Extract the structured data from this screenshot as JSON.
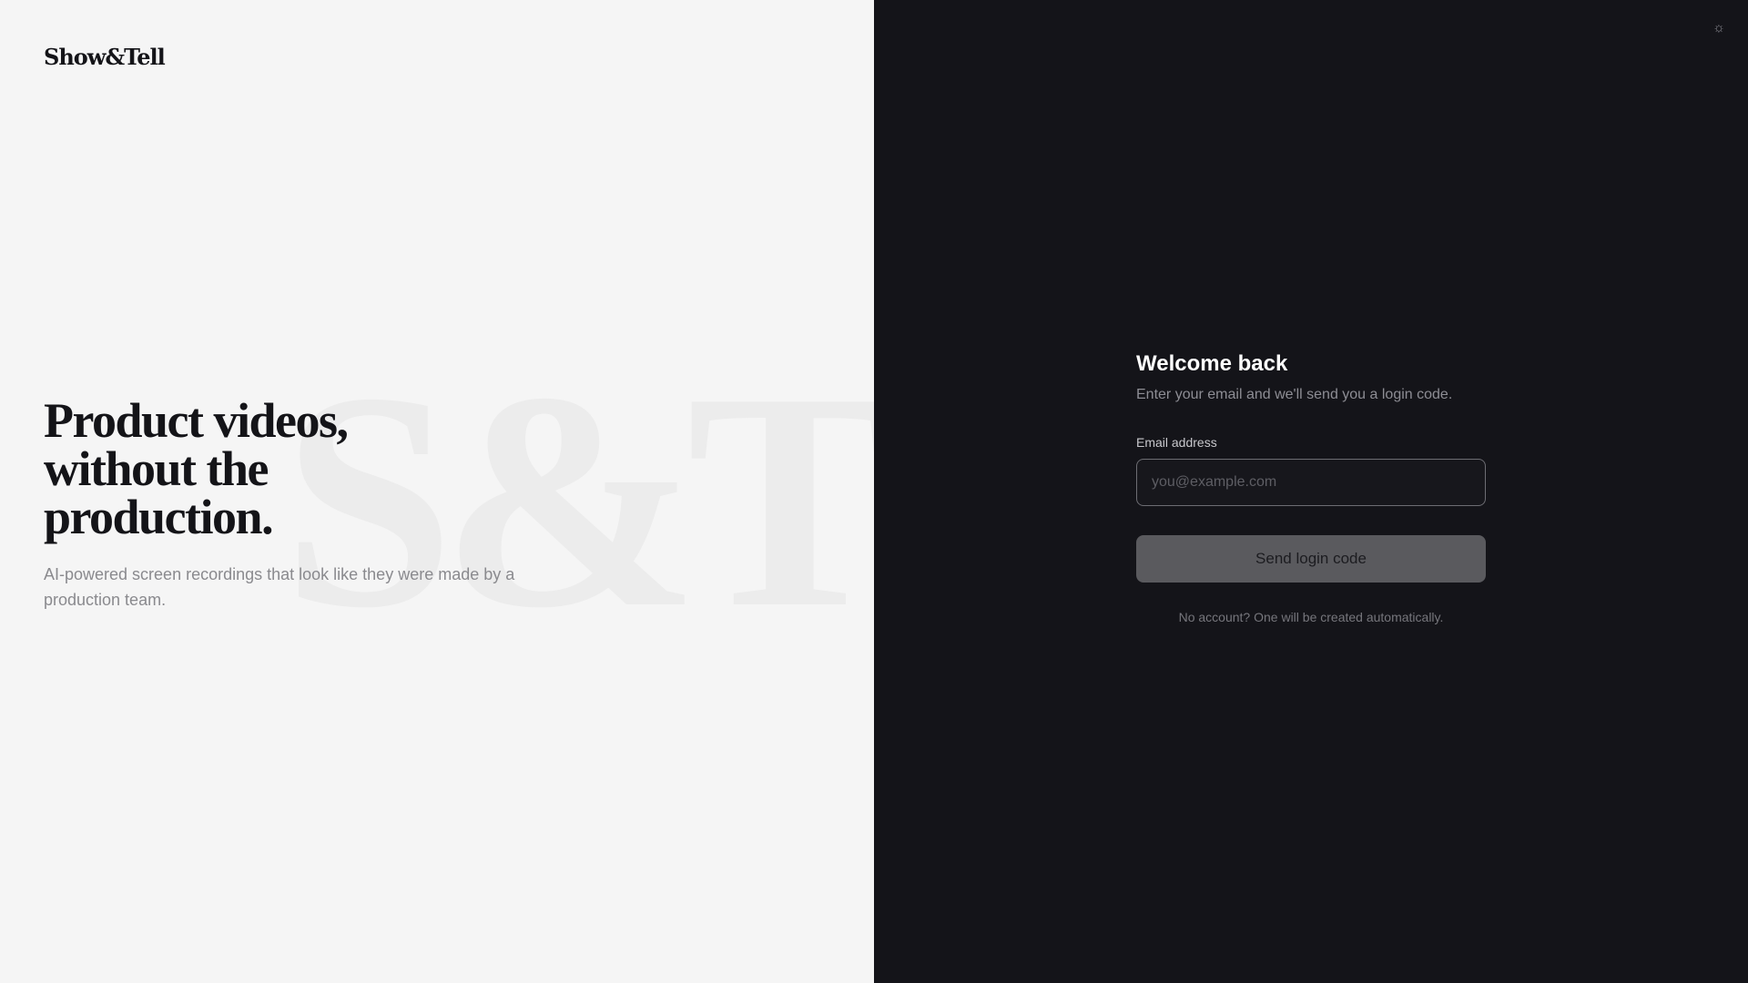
{
  "brand": {
    "logo_text": "Show&Tell",
    "watermark_text": "S&T"
  },
  "hero": {
    "headline_lines": [
      "Product videos,",
      "without the",
      "production."
    ],
    "subtext": "AI-powered screen recordings that look like they were made by a production team."
  },
  "theme_toggle": {
    "icon": "sun-icon",
    "glyph": "☼"
  },
  "login": {
    "title": "Welcome back",
    "subtitle": "Enter your email and we'll send you a login code.",
    "email_label": "Email address",
    "email_value": "",
    "email_placeholder": "you@example.com",
    "submit_label": "Send login code",
    "footnote": "No account? One will be created automatically."
  },
  "colors": {
    "left_bg": "#f5f5f5",
    "right_bg": "#141419",
    "button_bg": "#5a5a5e",
    "headline": "#141418"
  }
}
